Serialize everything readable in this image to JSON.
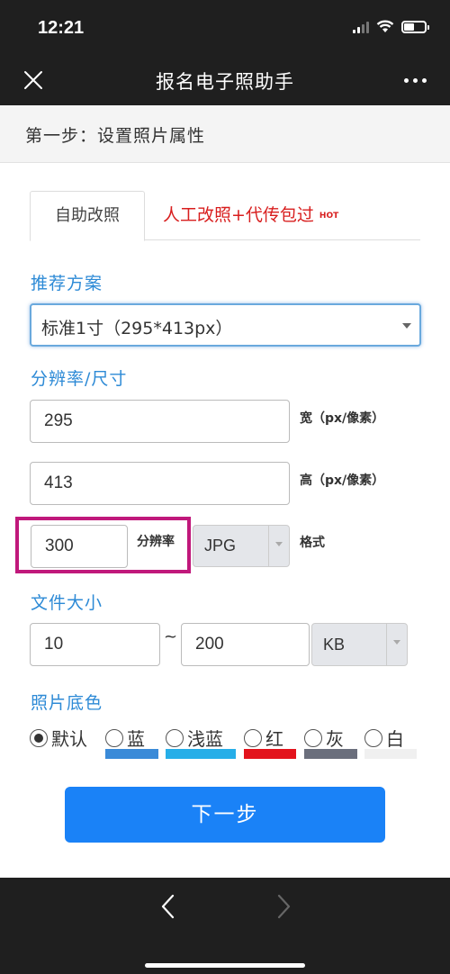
{
  "status_bar": {
    "time": "12:21"
  },
  "nav": {
    "title": "报名电子照助手"
  },
  "step_header": "第一步：设置照片属性",
  "tabs": {
    "active": "自助改照",
    "manual": "人工改照+代传包过",
    "hot_badge": "HOT"
  },
  "preset": {
    "title": "推荐方案",
    "selected": "标准1寸（295*413px）"
  },
  "resolution": {
    "title": "分辨率/尺寸",
    "width_value": "295",
    "width_label": "宽（px/像素）",
    "height_value": "413",
    "height_label": "高（px/像素）",
    "dpi_value": "300",
    "dpi_label": "分辨率",
    "format_selected": "JPG",
    "format_label": "格式"
  },
  "file_size": {
    "title": "文件大小",
    "min": "10",
    "separator": "~",
    "max": "200",
    "unit": "KB"
  },
  "background": {
    "title": "照片底色",
    "options": [
      {
        "label": "默认",
        "checked": true
      },
      {
        "label": "蓝",
        "color": "#3a8ad8"
      },
      {
        "label": "浅蓝",
        "color": "#26aee8"
      },
      {
        "label": "红",
        "color": "#e3131c"
      },
      {
        "label": "灰",
        "color": "#6a6e7c"
      },
      {
        "label": "白",
        "color": "#f0f0f0"
      }
    ]
  },
  "next_button": "下一步",
  "colors": {
    "accent": "#1a82f7",
    "section_title": "#2d8ad6",
    "hot_red": "#d81e1e",
    "highlight": "#c0187b"
  }
}
